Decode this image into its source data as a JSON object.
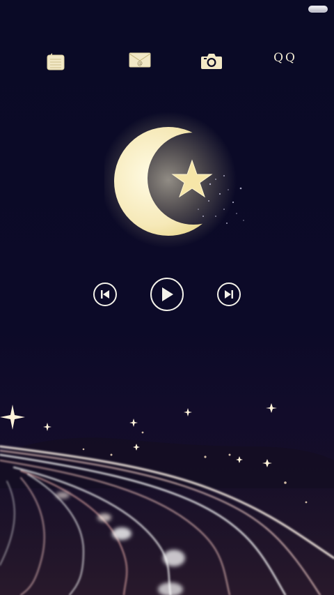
{
  "status_bar": {
    "battery_icon": "battery-icon"
  },
  "shortcuts": [
    {
      "name": "notes",
      "icon": "notepad-icon"
    },
    {
      "name": "mail",
      "icon": "envelope-icon",
      "glyph": "@"
    },
    {
      "name": "camera",
      "icon": "camera-icon"
    },
    {
      "name": "qq",
      "label": "QQ"
    }
  ],
  "widget": {
    "icon": "crescent-moon-star-icon"
  },
  "music_controls": {
    "previous_icon": "skip-previous-icon",
    "play_icon": "play-icon",
    "next_icon": "skip-next-icon"
  },
  "colors": {
    "background": "#0b0a24",
    "accent": "#f1ead2",
    "moon": "#f7edc4"
  }
}
